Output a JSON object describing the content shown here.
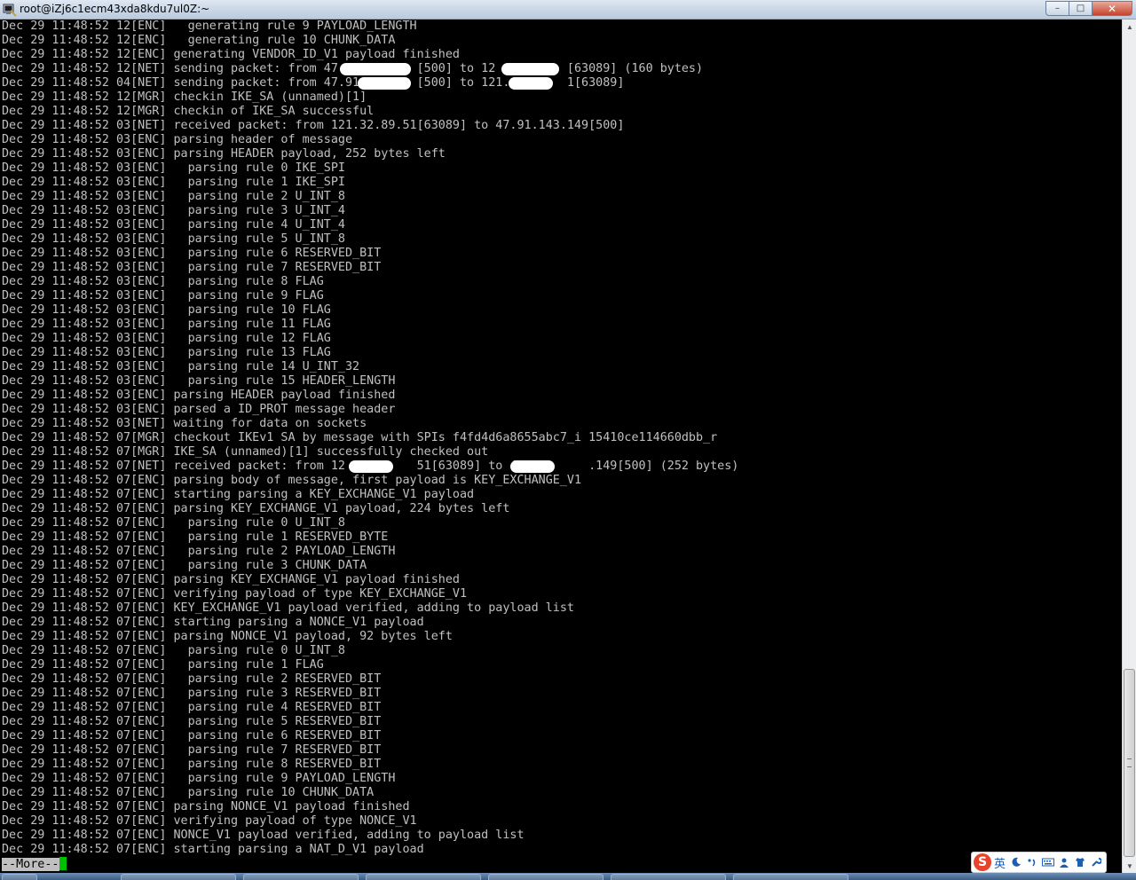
{
  "window": {
    "title": "root@iZj6c1ecm43xda8kdu7ul0Z:~",
    "minimize": "–",
    "maximize": "□",
    "close": "✕"
  },
  "terminal": {
    "lines": [
      "Dec 29 11:48:52 12[ENC]   generating rule 9 PAYLOAD_LENGTH",
      "Dec 29 11:48:52 12[ENC]   generating rule 10 CHUNK_DATA",
      "Dec 29 11:48:52 12[ENC] generating VENDOR_ID_V1 payload finished",
      "Dec 29 11:48:52 12[NET] sending packet: from 47.          [500] to 12          [63089] (160 bytes)",
      "Dec 29 11:48:52 04[NET] sending packet: from 47.91        [500] to 121.        1[63089]",
      "Dec 29 11:48:52 12[MGR] checkin IKE_SA (unnamed)[1]",
      "Dec 29 11:48:52 12[MGR] checkin of IKE_SA successful",
      "Dec 29 11:48:52 03[NET] received packet: from 121.32.89.51[63089] to 47.91.143.149[500]",
      "Dec 29 11:48:52 03[ENC] parsing header of message",
      "Dec 29 11:48:52 03[ENC] parsing HEADER payload, 252 bytes left",
      "Dec 29 11:48:52 03[ENC]   parsing rule 0 IKE_SPI",
      "Dec 29 11:48:52 03[ENC]   parsing rule 1 IKE_SPI",
      "Dec 29 11:48:52 03[ENC]   parsing rule 2 U_INT_8",
      "Dec 29 11:48:52 03[ENC]   parsing rule 3 U_INT_4",
      "Dec 29 11:48:52 03[ENC]   parsing rule 4 U_INT_4",
      "Dec 29 11:48:52 03[ENC]   parsing rule 5 U_INT_8",
      "Dec 29 11:48:52 03[ENC]   parsing rule 6 RESERVED_BIT",
      "Dec 29 11:48:52 03[ENC]   parsing rule 7 RESERVED_BIT",
      "Dec 29 11:48:52 03[ENC]   parsing rule 8 FLAG",
      "Dec 29 11:48:52 03[ENC]   parsing rule 9 FLAG",
      "Dec 29 11:48:52 03[ENC]   parsing rule 10 FLAG",
      "Dec 29 11:48:52 03[ENC]   parsing rule 11 FLAG",
      "Dec 29 11:48:52 03[ENC]   parsing rule 12 FLAG",
      "Dec 29 11:48:52 03[ENC]   parsing rule 13 FLAG",
      "Dec 29 11:48:52 03[ENC]   parsing rule 14 U_INT_32",
      "Dec 29 11:48:52 03[ENC]   parsing rule 15 HEADER_LENGTH",
      "Dec 29 11:48:52 03[ENC] parsing HEADER payload finished",
      "Dec 29 11:48:52 03[ENC] parsed a ID_PROT message header",
      "Dec 29 11:48:52 03[NET] waiting for data on sockets",
      "Dec 29 11:48:52 07[MGR] checkout IKEv1 SA by message with SPIs f4fd4d6a8655abc7_i 15410ce114660dbb_r",
      "Dec 29 11:48:52 07[MGR] IKE_SA (unnamed)[1] successfully checked out",
      "Dec 29 11:48:52 07[NET] received packet: from 12          51[63089] to 47.        .149[500] (252 bytes)",
      "Dec 29 11:48:52 07[ENC] parsing body of message, first payload is KEY_EXCHANGE_V1",
      "Dec 29 11:48:52 07[ENC] starting parsing a KEY_EXCHANGE_V1 payload",
      "Dec 29 11:48:52 07[ENC] parsing KEY_EXCHANGE_V1 payload, 224 bytes left",
      "Dec 29 11:48:52 07[ENC]   parsing rule 0 U_INT_8",
      "Dec 29 11:48:52 07[ENC]   parsing rule 1 RESERVED_BYTE",
      "Dec 29 11:48:52 07[ENC]   parsing rule 2 PAYLOAD_LENGTH",
      "Dec 29 11:48:52 07[ENC]   parsing rule 3 CHUNK_DATA",
      "Dec 29 11:48:52 07[ENC] parsing KEY_EXCHANGE_V1 payload finished",
      "Dec 29 11:48:52 07[ENC] verifying payload of type KEY_EXCHANGE_V1",
      "Dec 29 11:48:52 07[ENC] KEY_EXCHANGE_V1 payload verified, adding to payload list",
      "Dec 29 11:48:52 07[ENC] starting parsing a NONCE_V1 payload",
      "Dec 29 11:48:52 07[ENC] parsing NONCE_V1 payload, 92 bytes left",
      "Dec 29 11:48:52 07[ENC]   parsing rule 0 U_INT_8",
      "Dec 29 11:48:52 07[ENC]   parsing rule 1 FLAG",
      "Dec 29 11:48:52 07[ENC]   parsing rule 2 RESERVED_BIT",
      "Dec 29 11:48:52 07[ENC]   parsing rule 3 RESERVED_BIT",
      "Dec 29 11:48:52 07[ENC]   parsing rule 4 RESERVED_BIT",
      "Dec 29 11:48:52 07[ENC]   parsing rule 5 RESERVED_BIT",
      "Dec 29 11:48:52 07[ENC]   parsing rule 6 RESERVED_BIT",
      "Dec 29 11:48:52 07[ENC]   parsing rule 7 RESERVED_BIT",
      "Dec 29 11:48:52 07[ENC]   parsing rule 8 RESERVED_BIT",
      "Dec 29 11:48:52 07[ENC]   parsing rule 9 PAYLOAD_LENGTH",
      "Dec 29 11:48:52 07[ENC]   parsing rule 10 CHUNK_DATA",
      "Dec 29 11:48:52 07[ENC] parsing NONCE_V1 payload finished",
      "Dec 29 11:48:52 07[ENC] verifying payload of type NONCE_V1",
      "Dec 29 11:48:52 07[ENC] NONCE_V1 payload verified, adding to payload list",
      "Dec 29 11:48:52 07[ENC] starting parsing a NAT_D_V1 payload"
    ],
    "more_prompt": "--More--"
  },
  "ime": {
    "logo": "S",
    "language": "英"
  },
  "colors": {
    "terminal_bg": "#000000",
    "terminal_fg": "#c0c0c0",
    "cursor": "#00c000",
    "ime_brand": "#e8432b"
  }
}
